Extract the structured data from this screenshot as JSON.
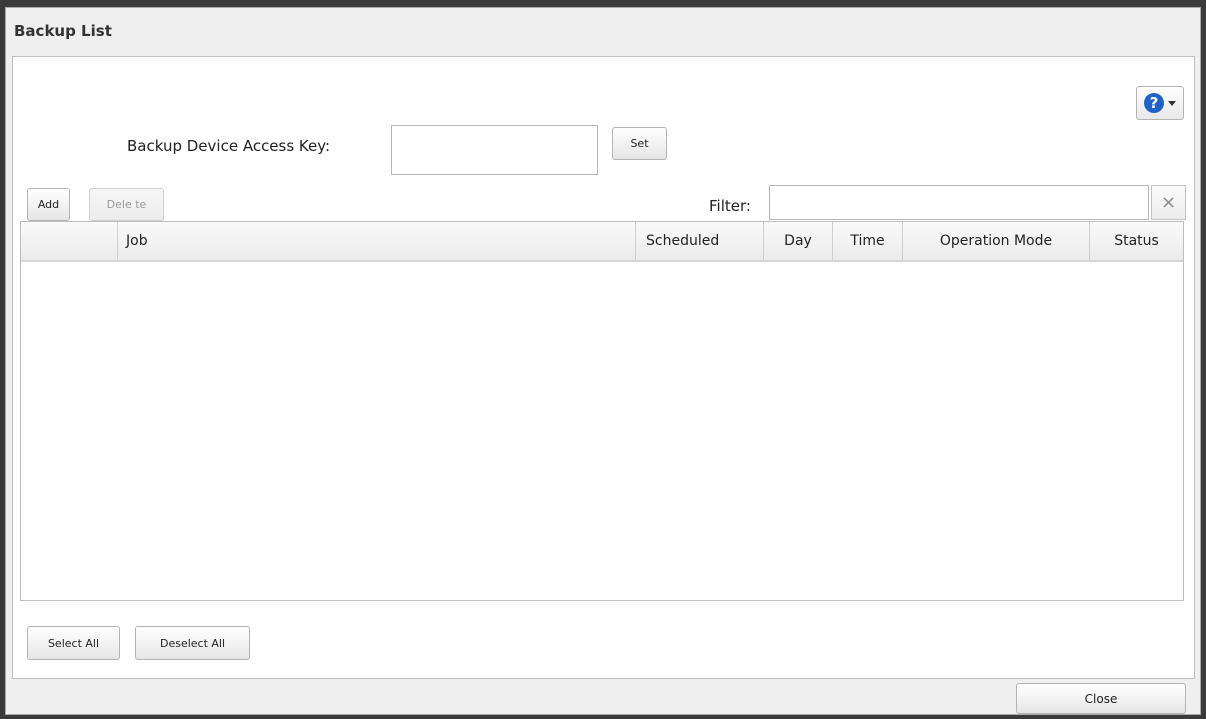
{
  "dialog": {
    "title": "Backup List"
  },
  "help": {
    "icon": "help-icon",
    "glyph": "?"
  },
  "access_key": {
    "label": "Backup Device Access Key:",
    "value": "",
    "set_label": "Set"
  },
  "toolbar": {
    "add_label": "Add",
    "delete_label": "Dele te"
  },
  "filter": {
    "label": "Filter:",
    "value": "",
    "clear_glyph": "×"
  },
  "table": {
    "columns": [
      "",
      "Job",
      "Scheduled",
      "Day",
      "Time",
      "Operation Mode",
      "Status"
    ],
    "rows": []
  },
  "selection": {
    "select_all_label": "Select All",
    "deselect_all_label": "Deselect All"
  },
  "footer": {
    "close_label": "Close"
  },
  "colors": {
    "accent": "#1f62c7"
  }
}
